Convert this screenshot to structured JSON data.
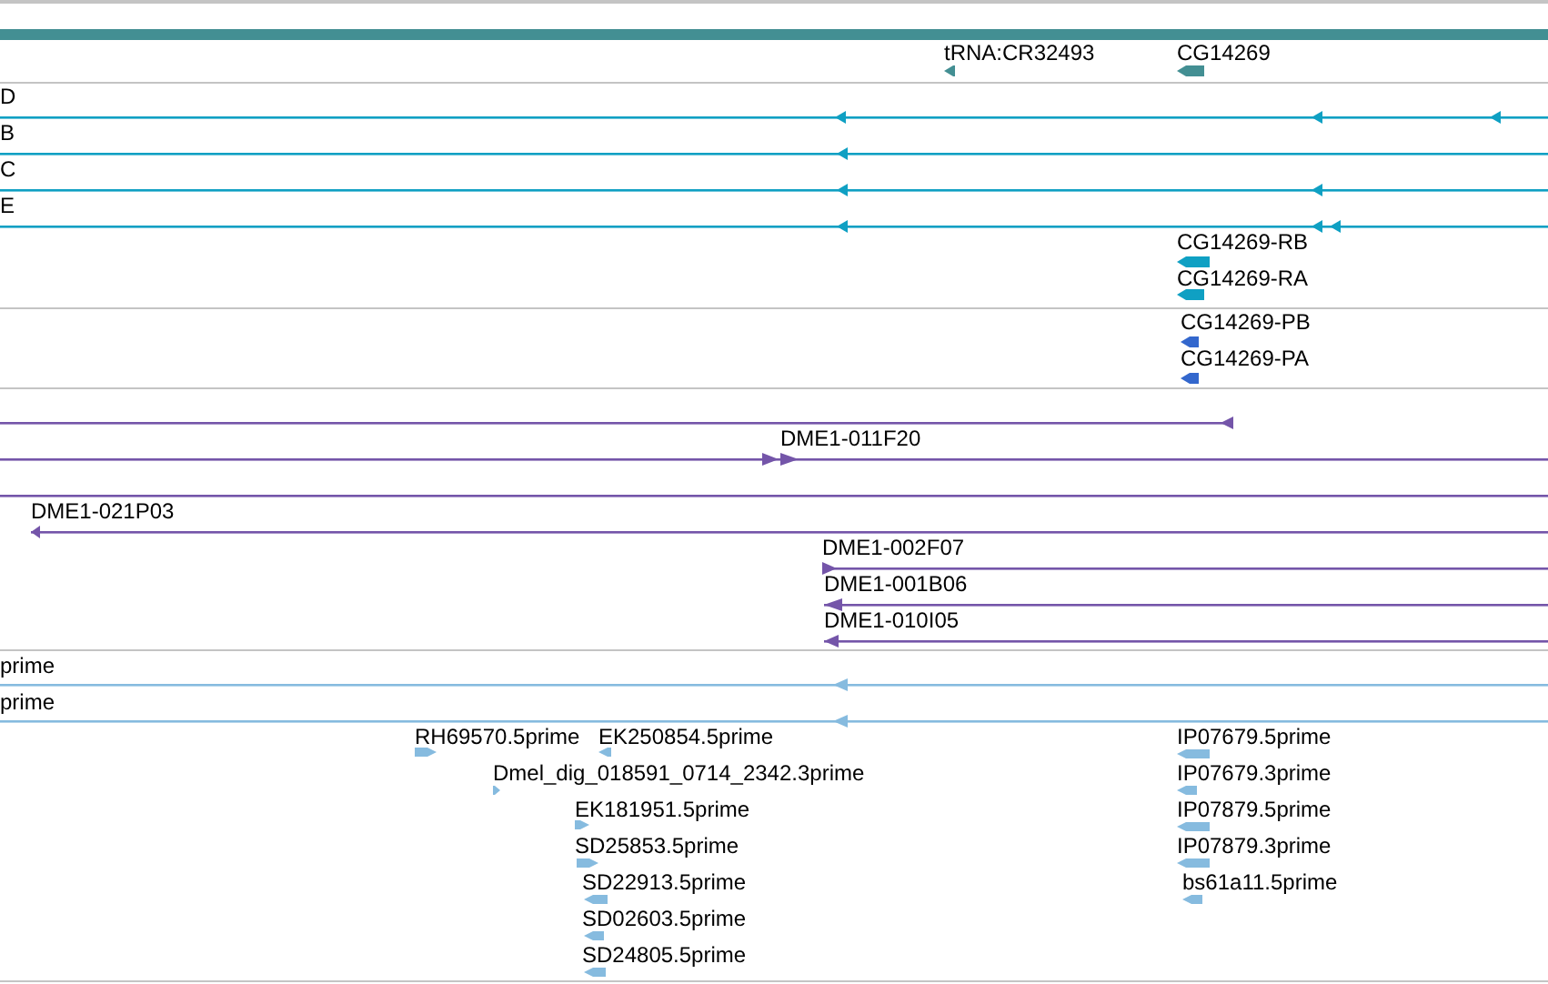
{
  "gene_track": {
    "features": [
      {
        "label": "tRNA:CR32493"
      },
      {
        "label": "CG14269"
      }
    ]
  },
  "transcript_track": {
    "features": [
      {
        "label": "D"
      },
      {
        "label": "B"
      },
      {
        "label": "C"
      },
      {
        "label": "E"
      },
      {
        "label": "CG14269-RB"
      },
      {
        "label": "CG14269-RA"
      }
    ]
  },
  "protein_track": {
    "features": [
      {
        "label": "CG14269-PB"
      },
      {
        "label": "CG14269-PA"
      }
    ]
  },
  "clone_track": {
    "features": [
      {
        "label": "DME1-011F20"
      },
      {
        "label": "DME1-021P03"
      },
      {
        "label": "DME1-002F07"
      },
      {
        "label": "DME1-001B06"
      },
      {
        "label": "DME1-010I05"
      }
    ]
  },
  "est_track": {
    "features": [
      {
        "label": "prime"
      },
      {
        "label": "prime"
      },
      {
        "label": "RH69570.5prime"
      },
      {
        "label": "EK250854.5prime"
      },
      {
        "label": "Dmel_dig_018591_0714_2342.3prime"
      },
      {
        "label": "EK181951.5prime"
      },
      {
        "label": "SD25853.5prime"
      },
      {
        "label": "SD22913.5prime"
      },
      {
        "label": "SD02603.5prime"
      },
      {
        "label": "SD24805.5prime"
      },
      {
        "label": "IP07679.5prime"
      },
      {
        "label": "IP07679.3prime"
      },
      {
        "label": "IP07879.5prime"
      },
      {
        "label": "IP07879.3prime"
      },
      {
        "label": "bs61a11.5prime"
      }
    ]
  }
}
